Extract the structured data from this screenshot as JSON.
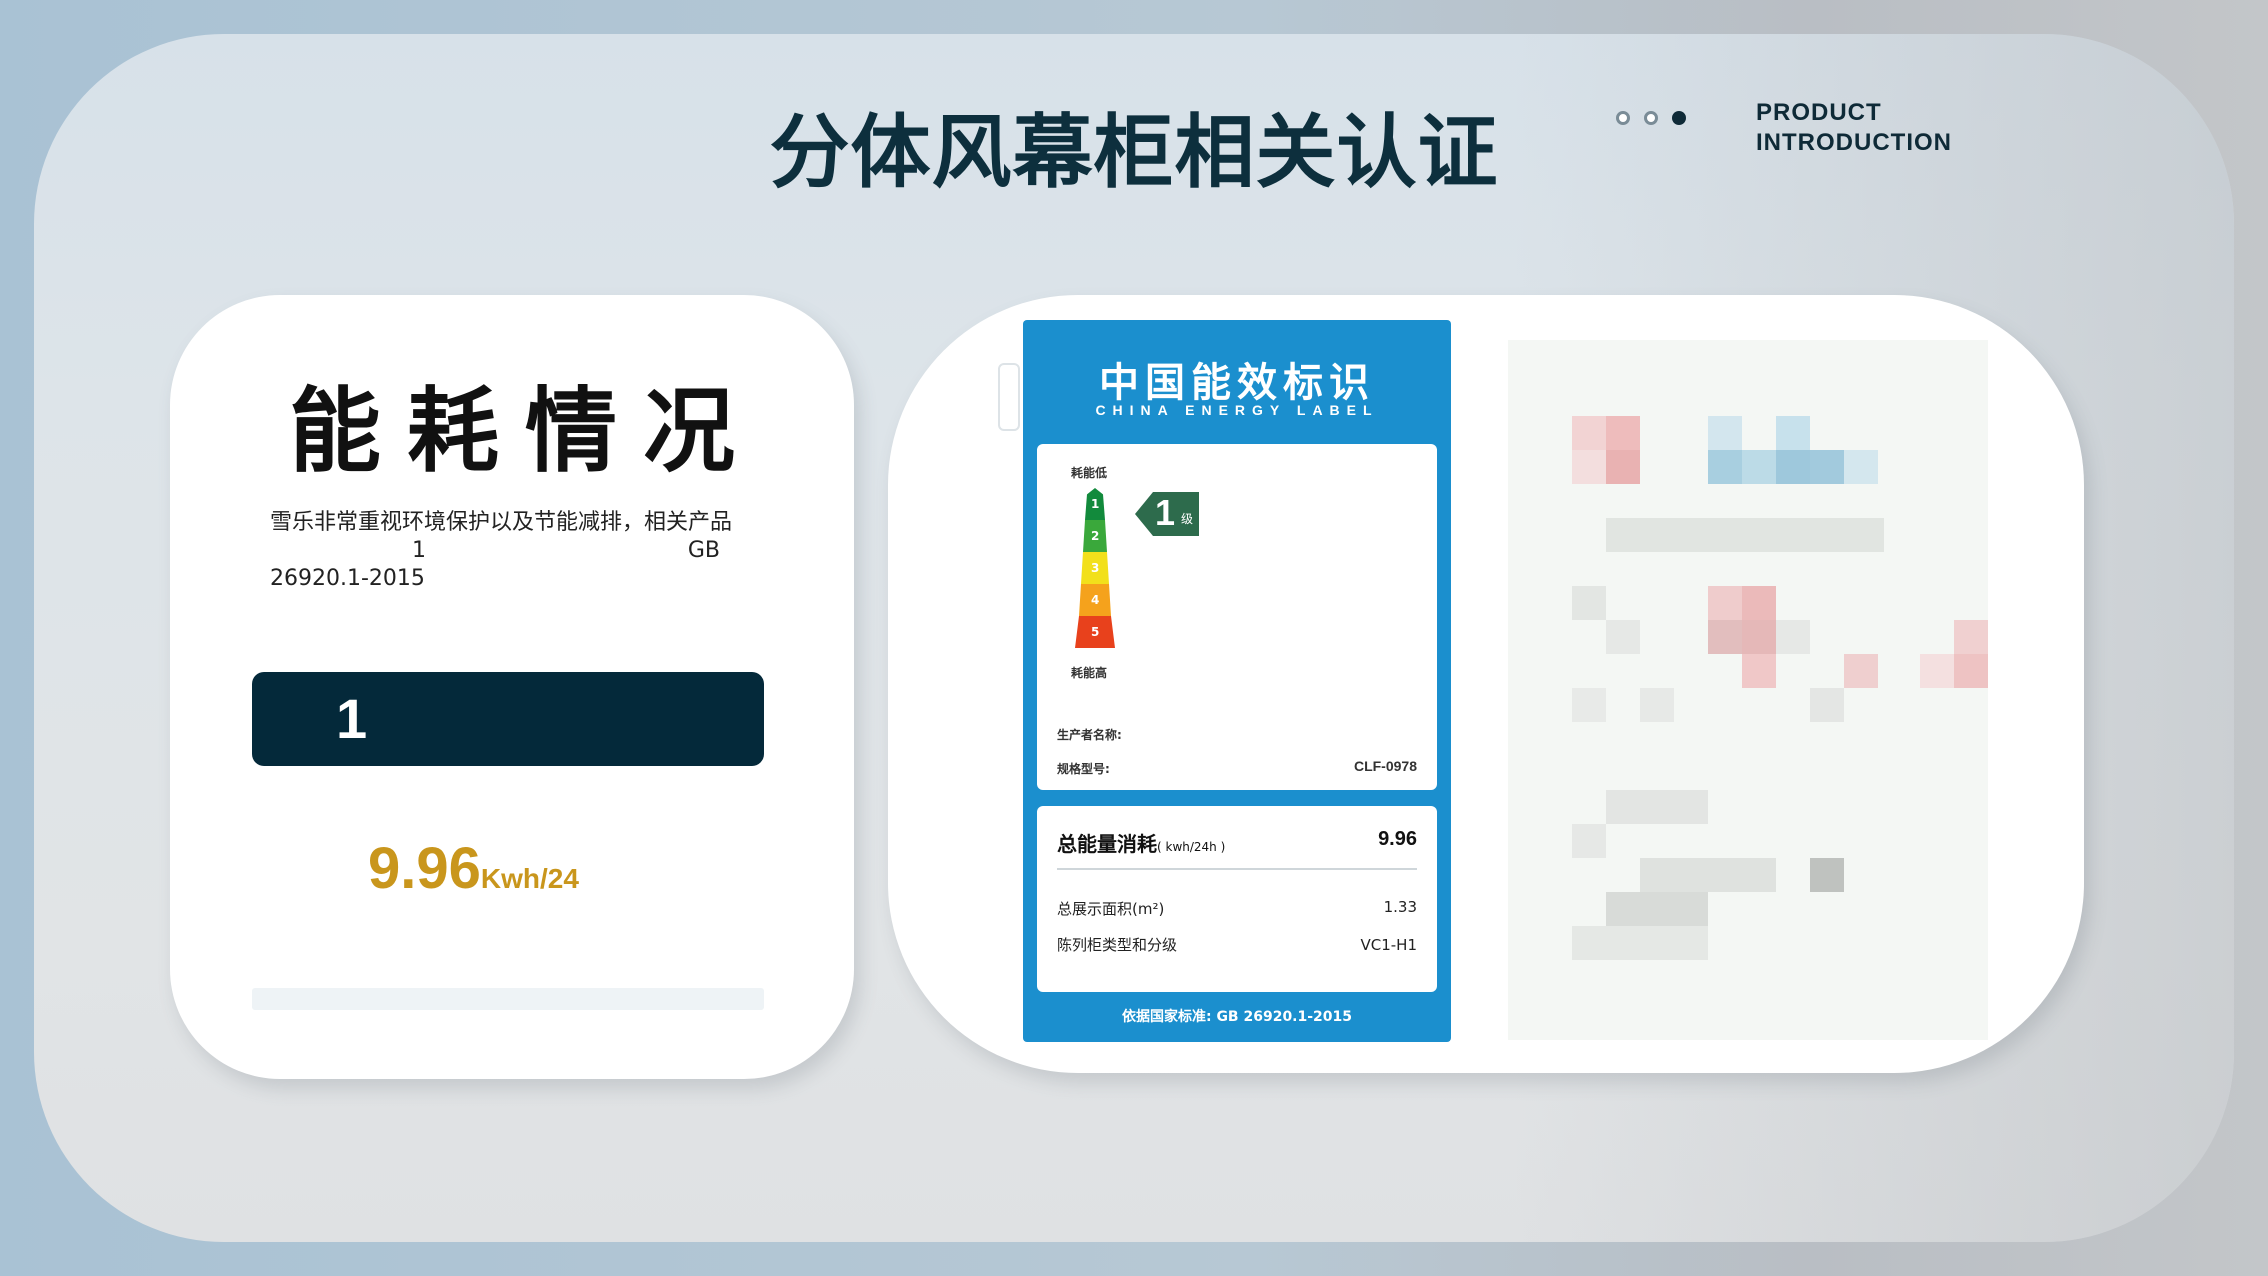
{
  "header": {
    "title": "分体风幕柜相关认证",
    "product_line1": "PRODUCT",
    "product_line2": "INTRODUCTION"
  },
  "left_card": {
    "heading": "能耗情况",
    "desc_line1": "雪乐非常重视环境保护以及节能减排，相关产品",
    "desc_num": "1",
    "desc_gb": "GB",
    "desc_line3": "26920.1-2015",
    "grade_bar": "1",
    "value": "9.96",
    "unit": "Kwh/24"
  },
  "energy_label": {
    "title_cn": "中国能效标识",
    "title_en": "CHINA ENERGY LABEL",
    "low": "耗能低",
    "high": "耗能高",
    "ranks": [
      "1",
      "2",
      "3",
      "4",
      "5"
    ],
    "grade": "1",
    "grade_suffix": "级",
    "maker_label": "生产者名称:",
    "model_label": "规格型号:",
    "model_value": "CLF-0978",
    "total_label": "总能量消耗",
    "total_unit": "( kwh/24h )",
    "total_value": "9.96",
    "area_label": "总展示面积(m²)",
    "area_value": "1.33",
    "type_label": "陈列柜类型和分级",
    "type_value": "VC1-H1",
    "standard": "依据国家标准: GB 26920.1-2015"
  },
  "colors": {
    "dark": "#04293a",
    "gold": "#c9961c",
    "label_blue": "#1b8fce"
  }
}
